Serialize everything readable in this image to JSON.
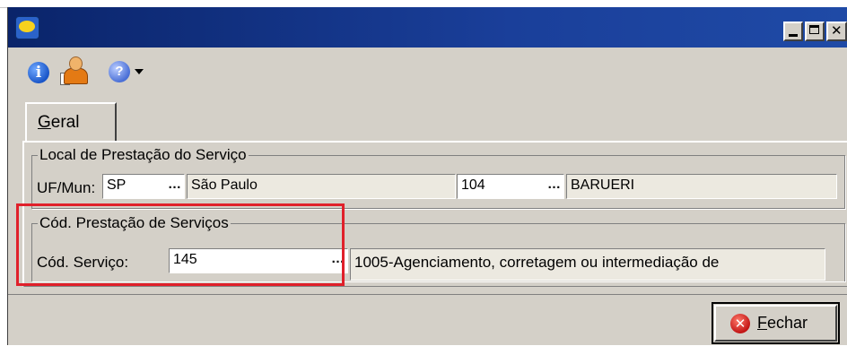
{
  "window": {
    "title": "",
    "controls": [
      "minimize",
      "maximize",
      "close"
    ]
  },
  "toolbar": {
    "icons": [
      "info-icon",
      "user-document-icon",
      "help-icon",
      "dropdown-caret-icon"
    ]
  },
  "tabs": [
    {
      "label": "Geral",
      "active": true
    }
  ],
  "local_prestacao": {
    "title": "Local de Prestação do Serviço",
    "uf_label": "UF/Mun:",
    "uf_value": "SP",
    "uf_name": "São Paulo",
    "mun_value": "104",
    "mun_name": "BARUERI"
  },
  "cod_prestacao": {
    "title": "Cód. Prestação de Serviços",
    "servico_label": "Cód. Serviço:",
    "servico_value": "145",
    "servico_desc": "1005-Agenciamento, corretagem ou intermediação de"
  },
  "lookup_button": "…",
  "footer": {
    "close_label": "Fechar"
  },
  "colors": {
    "titlebar": "#0a246a",
    "face": "#d4d0c8",
    "highlight": "#e0202a"
  }
}
